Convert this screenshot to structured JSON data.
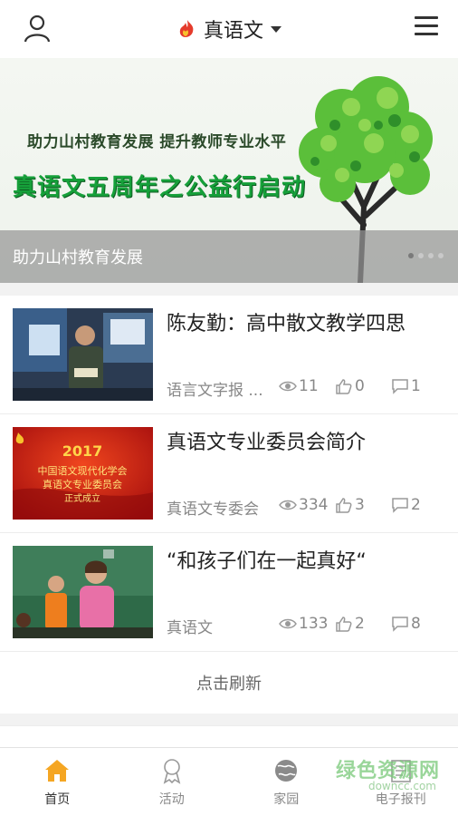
{
  "header": {
    "title": "真语文",
    "icons": {
      "left": "user-icon",
      "right": "hamburger-menu-icon",
      "logo": "flame-logo-icon"
    }
  },
  "banner": {
    "subtitle": "助力山村教育发展 提升教师专业水平",
    "headline": "真语文五周年之公益行启动",
    "caption": "助力山村教育发展",
    "slides": 4,
    "active_slide": 1
  },
  "articles": [
    {
      "title": "陈友勤：高中散文教学四思",
      "source": "语言文字报 ...",
      "views": "11",
      "likes": "0",
      "comments": "1"
    },
    {
      "title": "真语文专业委员会简介",
      "source": "真语文专委会",
      "views": "334",
      "likes": "3",
      "comments": "2"
    },
    {
      "title": "“和孩子们在一起真好“",
      "source": "真语文",
      "views": "133",
      "likes": "2",
      "comments": "8"
    }
  ],
  "thumb2": {
    "year": "2017",
    "line1": "中国语文现代化学会",
    "line2": "真语文专业委员会",
    "line3": "正式成立"
  },
  "refresh_label": "点击刷新",
  "tabs": [
    {
      "label": "首页",
      "icon": "home-icon",
      "active": true
    },
    {
      "label": "活动",
      "icon": "award-ribbon-icon",
      "active": false
    },
    {
      "label": "家园",
      "icon": "globe-icon",
      "active": false
    },
    {
      "label": "电子报刊",
      "icon": "newspaper-icon",
      "active": false
    }
  ],
  "watermark": {
    "text": "绿色资源网",
    "url": "downcc.com"
  },
  "colors": {
    "accent": "#f5a623",
    "banner_green": "#16a03a",
    "text": "#222222",
    "muted": "#888888"
  }
}
